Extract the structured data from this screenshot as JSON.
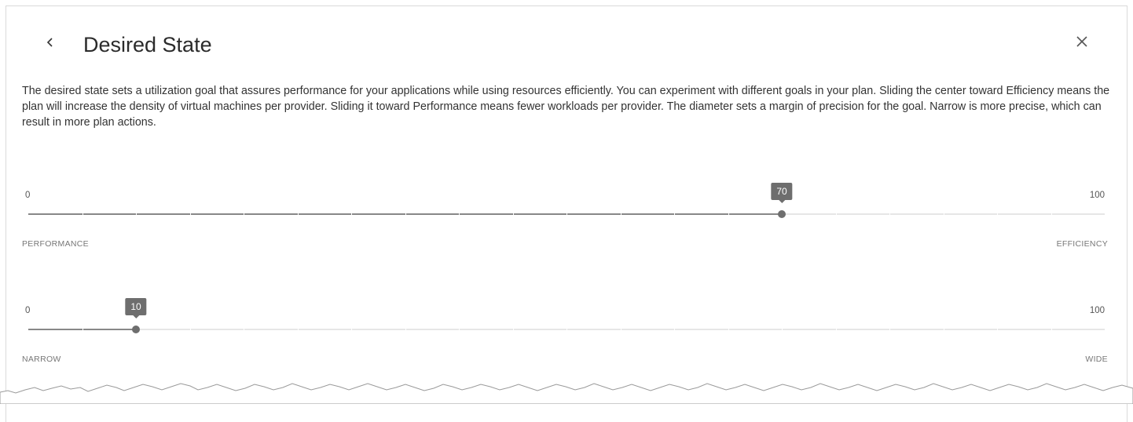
{
  "header": {
    "title": "Desired State",
    "back_icon": "chevron-left-icon",
    "close_icon": "close-icon"
  },
  "description": "The desired state sets a utilization goal that assures performance for your applications while using resources efficiently. You can experiment with different goals in your plan. Sliding the center toward Efficiency means the plan will increase the density of virtual machines per provider. Sliding it toward Performance means fewer workloads per provider. The diameter sets a margin of precision for the goal. Narrow is more precise, which can result in more plan actions.",
  "center_slider": {
    "min": "0",
    "max": "100",
    "value": 70,
    "value_label": "70",
    "left_caption": "PERFORMANCE",
    "right_caption": "EFFICIENCY"
  },
  "diameter_slider": {
    "min": "0",
    "max": "100",
    "value": 10,
    "value_label": "10",
    "left_caption": "NARROW",
    "right_caption": "WIDE"
  },
  "colors": {
    "track": "#e6e6e6",
    "fill": "#888888",
    "handle": "#6e6e6e",
    "text": "#333333"
  }
}
